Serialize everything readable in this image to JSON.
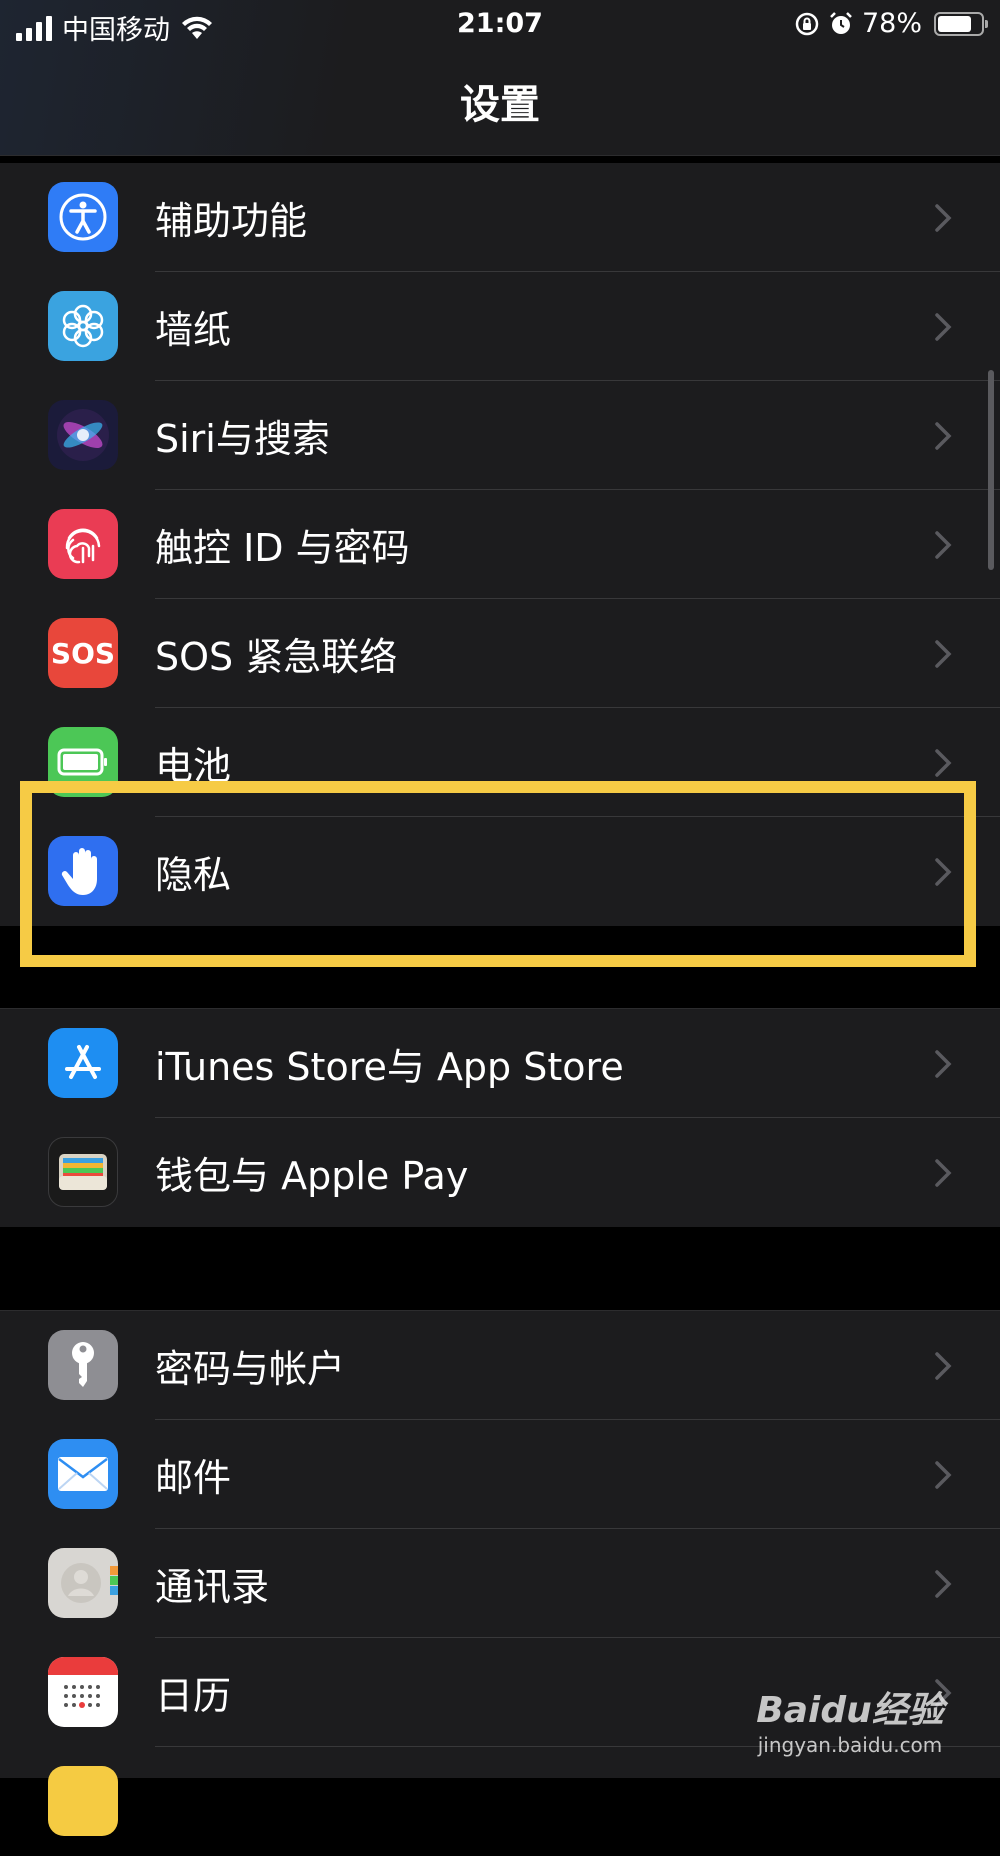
{
  "status_bar": {
    "carrier": "中国移动",
    "time": "21:07",
    "battery_percent": "78%",
    "battery_level": 0.78
  },
  "nav": {
    "title": "设置"
  },
  "group1": [
    {
      "label": "辅助功能",
      "icon": "accessibility-icon",
      "color": "#2f7cf6"
    },
    {
      "label": "墙纸",
      "icon": "wallpaper-flower-icon",
      "color": "#3aa3e0"
    },
    {
      "label": "Siri与搜索",
      "icon": "siri-icon",
      "color": "#1b1b3a"
    },
    {
      "label": "触控 ID 与密码",
      "icon": "fingerprint-icon",
      "color": "#ea3c54"
    },
    {
      "label": "SOS 紧急联络",
      "icon": "sos-icon",
      "color": "#e8473b",
      "icon_text": "SOS"
    },
    {
      "label": "电池",
      "icon": "battery-icon",
      "color": "#4cc756"
    },
    {
      "label": "隐私",
      "icon": "privacy-hand-icon",
      "color": "#2f6ff0"
    }
  ],
  "group2": [
    {
      "label": "iTunes Store与 App Store",
      "icon": "app-store-icon",
      "color": "#1e8ef2"
    },
    {
      "label": "钱包与 Apple Pay",
      "icon": "wallet-icon",
      "color": "#1a1a1a"
    }
  ],
  "group3": [
    {
      "label": "密码与帐户",
      "icon": "key-icon",
      "color": "#8e8e93"
    },
    {
      "label": "邮件",
      "icon": "mail-icon",
      "color": "#2e8ef2"
    },
    {
      "label": "通讯录",
      "icon": "contacts-icon",
      "color": "#d8d6d2"
    },
    {
      "label": "日历",
      "icon": "calendar-icon",
      "color": "#ffffff"
    }
  ],
  "highlight_color": "#f6cb45",
  "watermark": {
    "logo": "Baidu经验",
    "url": "jingyan.baidu.com"
  }
}
